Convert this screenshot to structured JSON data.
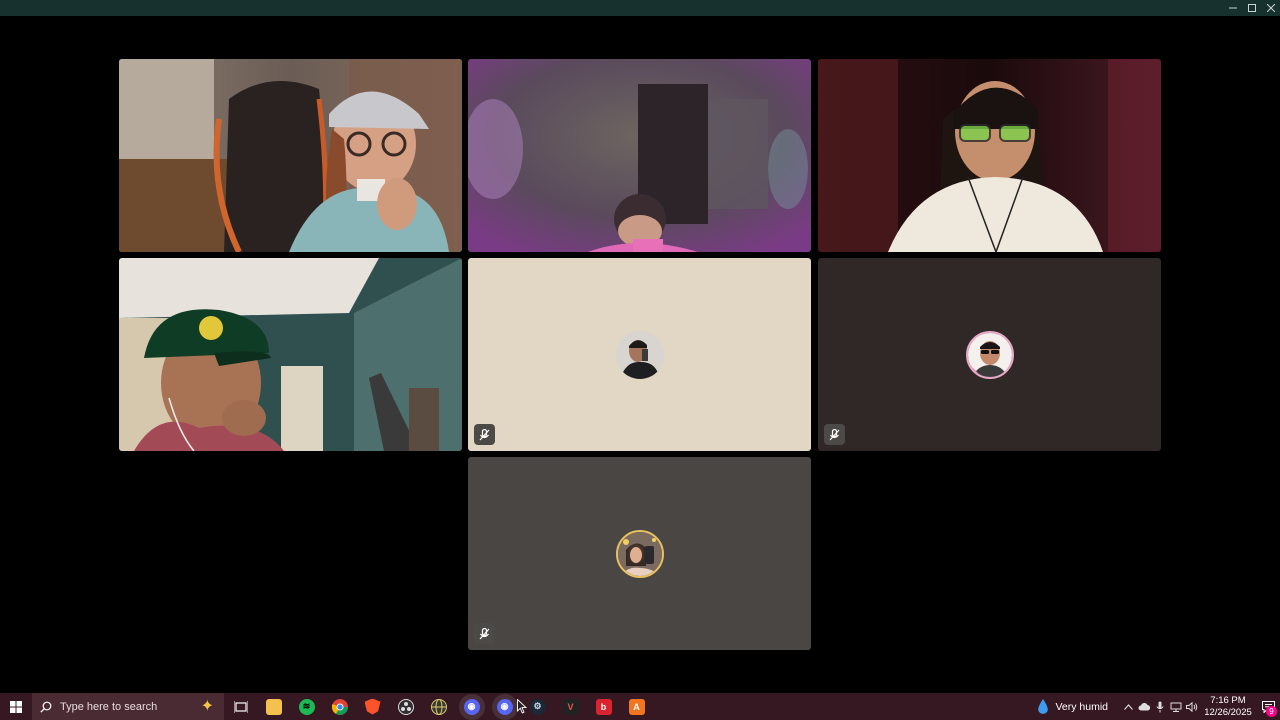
{
  "window": {
    "controls": {
      "minimize": "–",
      "maximize": "☐",
      "close": "✕"
    }
  },
  "participants": [
    {
      "video_on": true,
      "speaking": true,
      "muted": false,
      "scene": "cap-woman"
    },
    {
      "video_on": true,
      "speaking": false,
      "muted": false,
      "scene": "purple-room"
    },
    {
      "video_on": true,
      "speaking": false,
      "muted": false,
      "scene": "glasses-man"
    },
    {
      "video_on": true,
      "speaking": false,
      "muted": false,
      "scene": "green-cap-man"
    },
    {
      "video_on": false,
      "speaking": false,
      "muted": true,
      "tile_color": "#e2d6c4",
      "avatar": "mirror-selfie-avatar"
    },
    {
      "video_on": false,
      "speaking": false,
      "muted": true,
      "tile_color": "#302826",
      "avatar": "sunglasses-avatar"
    },
    {
      "video_on": false,
      "speaking": false,
      "muted": true,
      "tile_color": "#4a4643",
      "avatar": "selfie-woman-avatar"
    }
  ],
  "taskbar": {
    "search_placeholder": "Type here to search",
    "apps": [
      "task-view",
      "file-explorer",
      "spotify",
      "chrome",
      "brave",
      "obs",
      "browser",
      "discord-canary",
      "discord",
      "steam",
      "vortex",
      "bitwarden",
      "arc"
    ],
    "weather": "Very humid",
    "time": "7:16 PM",
    "date": "12/26/2025",
    "notification_count": "9"
  },
  "colors": {
    "background": "#000000",
    "title_bar": "#17322e",
    "taskbar": "#351821",
    "speaking_outline": "#5fb86a"
  }
}
